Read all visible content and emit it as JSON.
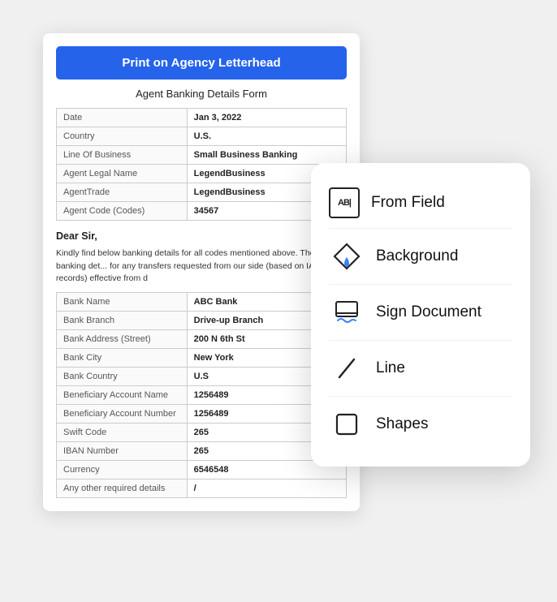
{
  "document": {
    "header_button": "Print on Agency Letterhead",
    "subtitle": "Agent Banking Details Form",
    "top_table": [
      {
        "label": "Date",
        "value": "Jan 3, 2022"
      },
      {
        "label": "Country",
        "value": "U.S."
      },
      {
        "label": "Line Of Business",
        "value": "Small Business Banking"
      },
      {
        "label": "Agent Legal Name",
        "value": "LegendBusiness"
      },
      {
        "label": "AgentTrade",
        "value": "LegendBusiness"
      },
      {
        "label": "Agent Code (Codes)",
        "value": "34567"
      }
    ],
    "salutation": "Dear Sir,",
    "body": "Kindly find below banking details for all codes mentioned above. Those banking det... for any transfers requested from our side (based on IATA's records) effective from d",
    "bottom_table": [
      {
        "label": "Bank Name",
        "value": "ABC Bank"
      },
      {
        "label": "Bank Branch",
        "value": "Drive-up Branch"
      },
      {
        "label": "Bank Address (Street)",
        "value": "200 N 6th St"
      },
      {
        "label": "Bank City",
        "value": "New York"
      },
      {
        "label": "Bank Country",
        "value": "U.S"
      },
      {
        "label": "Beneficiary Account Name",
        "value": "1256489"
      },
      {
        "label": "Beneficiary Account Number",
        "value": "1256489"
      },
      {
        "label": "Swift Code",
        "value": "265"
      },
      {
        "label": "IBAN Number",
        "value": "265"
      },
      {
        "label": "Currency",
        "value": "6546548"
      },
      {
        "label": "Any other required details",
        "value": "/"
      }
    ]
  },
  "menu": {
    "items": [
      {
        "id": "from-field",
        "label": "From Field",
        "icon": "from-field-icon"
      },
      {
        "id": "background",
        "label": "Background",
        "icon": "background-icon"
      },
      {
        "id": "sign-document",
        "label": "Sign Document",
        "icon": "sign-document-icon"
      },
      {
        "id": "line",
        "label": "Line",
        "icon": "line-icon"
      },
      {
        "id": "shapes",
        "label": "Shapes",
        "icon": "shapes-icon"
      }
    ]
  }
}
